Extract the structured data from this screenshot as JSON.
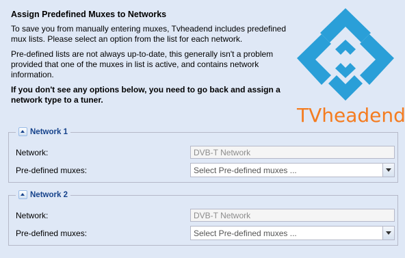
{
  "intro": {
    "title": "Assign Predefined Muxes to Networks",
    "p1": "To save you from manually entering muxes, Tvheadend includes predefined mux lists. Please select an option from the list for each network.",
    "p2": "Pre-defined lists are not always up-to-date, this generally isn't a problem provided that one of the muxes in list is active, and contains network information.",
    "p3": "If you don't see any options below, you need to go back and assign a network type to a tuner."
  },
  "logo": {
    "text": "TVheadend",
    "icon": "tvheadend-logo-icon",
    "colors": {
      "blue": "#2a9fd8",
      "orange": "#f47c20"
    }
  },
  "networks": [
    {
      "legend": "Network 1",
      "network_label": "Network:",
      "network_value": "DVB-T Network",
      "muxes_label": "Pre-defined muxes:",
      "muxes_placeholder": "Select Pre-defined muxes ..."
    },
    {
      "legend": "Network 2",
      "network_label": "Network:",
      "network_value": "DVB-T Network",
      "muxes_label": "Pre-defined muxes:",
      "muxes_placeholder": "Select Pre-defined muxes ..."
    }
  ],
  "colors": {
    "background": "#dfe8f6",
    "legend_text": "#15428b"
  }
}
